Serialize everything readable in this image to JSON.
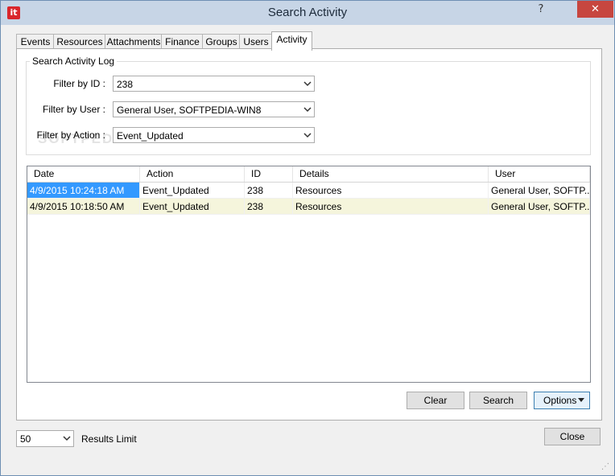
{
  "window": {
    "title": "Search Activity",
    "icon_text": "it",
    "help_glyph": "?",
    "min_glyph": "–",
    "max_glyph": "☐",
    "close_glyph": "✕"
  },
  "tabs": [
    "Events",
    "Resources",
    "Attachments",
    "Finance",
    "Groups",
    "Users",
    "Activity"
  ],
  "active_tab": "Activity",
  "search_log": {
    "title": "Search Activity Log",
    "filter_id": {
      "label": "Filter by ID :",
      "value": "238"
    },
    "filter_user": {
      "label": "Filter by User :",
      "value": "General User, SOFTPEDIA-WIN8"
    },
    "filter_action": {
      "label": "Filter by Action :",
      "value": "Event_Updated"
    },
    "watermark": "SOFTPEDIA"
  },
  "grid": {
    "columns": [
      "Date",
      "Action",
      "ID",
      "Details",
      "User"
    ],
    "rows": [
      [
        "4/9/2015 10:24:18 AM",
        "Event_Updated",
        "238",
        "Resources",
        "General User, SOFTP..."
      ],
      [
        "4/9/2015 10:18:50 AM",
        "Event_Updated",
        "238",
        "Resources",
        "General User, SOFTP..."
      ]
    ]
  },
  "buttons": {
    "clear": "Clear",
    "search": "Search",
    "options": "Options",
    "close": "Close"
  },
  "results_limit": {
    "value": "50",
    "label": "Results Limit"
  },
  "colors": {
    "selection": "#3399ff",
    "alt_row": "#f5f5dc",
    "close_button": "#c7463f"
  }
}
